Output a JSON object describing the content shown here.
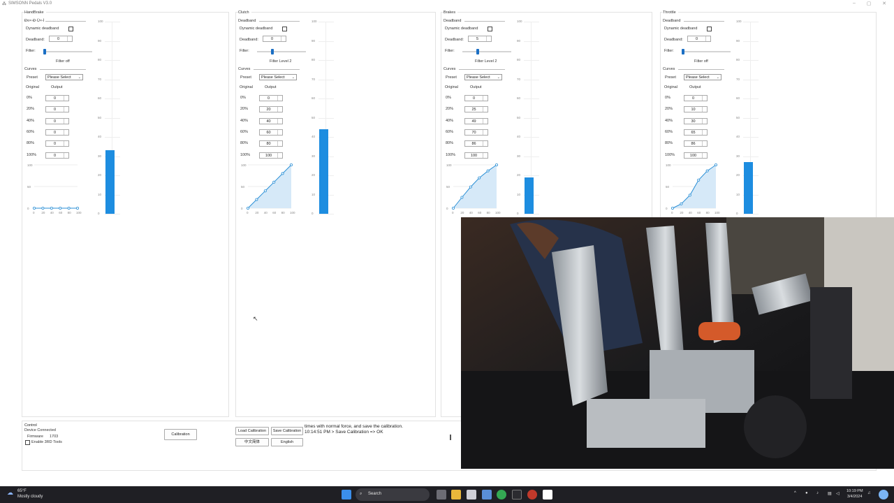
{
  "window": {
    "title": "SIMSONN Pedals V3.0",
    "minimize": "–",
    "maximize": "▢",
    "close": "✕"
  },
  "panels": [
    {
      "title": "HandBrake",
      "deadband_heading": "Ð¤×-Ð·Ù×-Ì",
      "dynamic_deadband": "Dynamic deadband",
      "deadband_label": "Deadband:",
      "deadband_value": "0",
      "filter_label": "Filter:",
      "filter_text": "Filter off",
      "filter_level": 0.0,
      "curves_label": "Curves",
      "preset_label": "Preset",
      "preset_value": "Please Select",
      "original_label": "Original",
      "output_label": "Output",
      "rows": [
        {
          "pct": "0%",
          "out": "0"
        },
        {
          "pct": "20%",
          "out": "0"
        },
        {
          "pct": "40%",
          "out": "0"
        },
        {
          "pct": "60%",
          "out": "0"
        },
        {
          "pct": "80%",
          "out": "0"
        },
        {
          "pct": "100%",
          "out": "0"
        }
      ],
      "bar_value": 33
    },
    {
      "title": "Clutch",
      "deadband_heading": "Deadband",
      "dynamic_deadband": "Dynamic deadband",
      "deadband_label": "Deadband:",
      "deadband_value": "0",
      "filter_label": "Filter:",
      "filter_text": "Filter Level 2",
      "filter_level": 0.3,
      "curves_label": "Curves",
      "preset_label": "Preset",
      "preset_value": "Please Select",
      "original_label": "Original",
      "output_label": "Output",
      "rows": [
        {
          "pct": "0%",
          "out": "0"
        },
        {
          "pct": "20%",
          "out": "20"
        },
        {
          "pct": "40%",
          "out": "40"
        },
        {
          "pct": "60%",
          "out": "60"
        },
        {
          "pct": "80%",
          "out": "80"
        },
        {
          "pct": "100%",
          "out": "100"
        }
      ],
      "bar_value": 44
    },
    {
      "title": "Brakes",
      "deadband_heading": "Deadband",
      "dynamic_deadband": "Dynamic deadband",
      "deadband_label": "Deadband:",
      "deadband_value": "5",
      "filter_label": "Filter:",
      "filter_text": "Filter Level 2",
      "filter_level": 0.3,
      "curves_label": "Curves",
      "preset_label": "Preset",
      "preset_value": "Please Select",
      "original_label": "Original",
      "output_label": "Output",
      "rows": [
        {
          "pct": "0%",
          "out": "0"
        },
        {
          "pct": "20%",
          "out": "25"
        },
        {
          "pct": "40%",
          "out": "49"
        },
        {
          "pct": "60%",
          "out": "70"
        },
        {
          "pct": "80%",
          "out": "86"
        },
        {
          "pct": "100%",
          "out": "100"
        }
      ],
      "bar_value": 19
    },
    {
      "title": "Throttle",
      "deadband_heading": "Deadband",
      "dynamic_deadband": "Dynamic deadband",
      "deadband_label": "Deadband:",
      "deadband_value": "0",
      "filter_label": "Filter:",
      "filter_text": "Filter off",
      "filter_level": 0.0,
      "curves_label": "Curves",
      "preset_label": "Preset",
      "preset_value": "Please Select",
      "original_label": "Original",
      "output_label": "Output",
      "rows": [
        {
          "pct": "0%",
          "out": "0"
        },
        {
          "pct": "20%",
          "out": "10"
        },
        {
          "pct": "40%",
          "out": "30"
        },
        {
          "pct": "60%",
          "out": "65"
        },
        {
          "pct": "80%",
          "out": "86"
        },
        {
          "pct": "100%",
          "out": "100"
        }
      ],
      "bar_value": 27
    }
  ],
  "scale_ticks": [
    "100",
    "90",
    "80",
    "70",
    "60",
    "50",
    "40",
    "30",
    "20",
    "10",
    "0"
  ],
  "curve_x_ticks": [
    "0",
    "20",
    "40",
    "60",
    "80",
    "100"
  ],
  "curve_y_ticks": [
    "100",
    "50",
    "0"
  ],
  "control": {
    "title": "Control",
    "status": "Device Connected",
    "firmware_label": "Firmware",
    "firmware_value": "1703",
    "enable_3rd": "Enable 3RD Tools",
    "calibration": "Calibration",
    "load_calibration": "Load Calibration",
    "save_calibration": "Save Calibration",
    "chinese": "中文简体",
    "english": "English",
    "log_line1": "times with normal force, and save the calibration.",
    "log_line2": "10:14:51 PM > Save Calibration => OK"
  },
  "taskbar": {
    "weather_temp": "65°F",
    "weather_text": "Mostly cloudy",
    "search": "Search",
    "time": "10:19 PM",
    "date": "3/4/2024"
  },
  "colors": {
    "accent": "#1d8de0",
    "slider": "#1b6fc4",
    "curve": "#2a8fd6",
    "taskbar": "#1f1f24"
  }
}
